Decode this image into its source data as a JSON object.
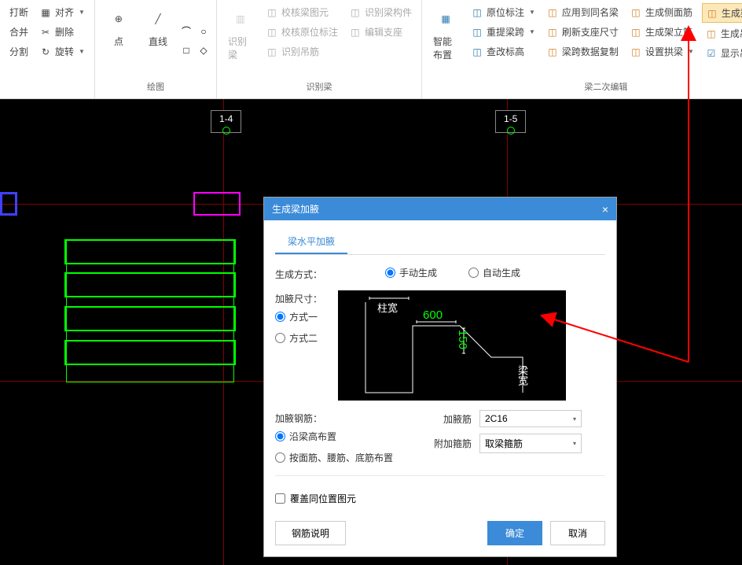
{
  "ribbon": {
    "group1": {
      "btn1": "打断",
      "btn2": "合并",
      "btn3": "分割",
      "btn4": "对齐",
      "btn5": "删除",
      "btn6": "旋转"
    },
    "group2": {
      "label": "绘图",
      "point": "点",
      "line": "直线"
    },
    "group3": {
      "label": "识别梁",
      "btn1": "识别梁",
      "btn2": "校核梁图元",
      "btn3": "校核原位标注",
      "btn4": "识别吊筋",
      "btn5": "识别梁构件",
      "btn6": "编辑支座"
    },
    "group4": {
      "label": "梁二次编辑",
      "smart": "智能布置",
      "col1_1": "原位标注",
      "col1_2": "重提梁跨",
      "col1_3": "查改标高",
      "col2_1": "应用到同名梁",
      "col2_2": "刷新支座尺寸",
      "col2_3": "梁跨数据复制",
      "col3_1": "生成侧面筋",
      "col3_2": "生成架立筋",
      "col3_3": "设置拱梁",
      "col4_1": "生成梁加腋",
      "col4_2": "生成吊筋",
      "col4_3": "显示吊筋"
    }
  },
  "canvas": {
    "axis1": "1-4",
    "axis2": "1-5"
  },
  "dialog": {
    "title": "生成梁加腋",
    "tab": "梁水平加腋",
    "gen_method_label": "生成方式：",
    "gen_manual": "手动生成",
    "gen_auto": "自动生成",
    "size_label": "加腋尺寸：",
    "method1": "方式一",
    "method2": "方式二",
    "diagram_pillar": "柱宽",
    "diagram_v1": "600",
    "diagram_v2": "150",
    "diagram_beam": "梁宽",
    "rebar_label": "加腋钢筋：",
    "layout1": "沿梁高布置",
    "layout2": "按面筋、腰筋、底筋布置",
    "field1_label": "加腋筋",
    "field1_value": "2C16",
    "field2_label": "附加箍筋",
    "field2_value": "取梁箍筋",
    "overwrite": "覆盖同位置图元",
    "btn_info": "钢筋说明",
    "btn_ok": "确定",
    "btn_cancel": "取消"
  }
}
